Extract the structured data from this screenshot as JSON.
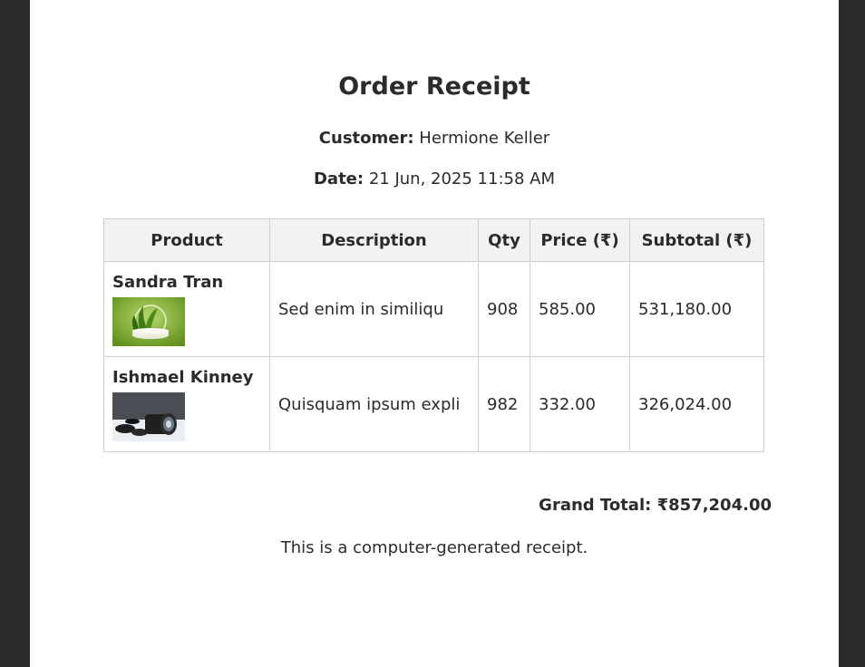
{
  "receipt": {
    "title": "Order Receipt",
    "customer_label": "Customer:",
    "customer_name": "Hermione Keller",
    "date_label": "Date:",
    "date_value": "21 Jun, 2025 11:58 AM",
    "columns": [
      "Product",
      "Description",
      "Qty",
      "Price (₹)",
      "Subtotal (₹)"
    ],
    "items": [
      {
        "product": "Sandra Tran",
        "image_icon": "product-podium-image",
        "description": "Sed enim in similiqu",
        "qty": "908",
        "price": "585.00",
        "subtotal": "531,180.00"
      },
      {
        "product": "Ishmael Kinney",
        "image_icon": "camera-lens-image",
        "description": "Quisquam ipsum expli",
        "qty": "982",
        "price": "332.00",
        "subtotal": "326,024.00"
      }
    ],
    "grand_total_label": "Grand Total:",
    "grand_total_value": "₹857,204.00",
    "footer_note": "This is a computer-generated receipt."
  },
  "colors": {
    "backdrop": "#2b2b2b",
    "page": "#ffffff",
    "header_bg": "#f2f2f2",
    "border": "#cfcfcf",
    "text": "#2b2b2b"
  }
}
